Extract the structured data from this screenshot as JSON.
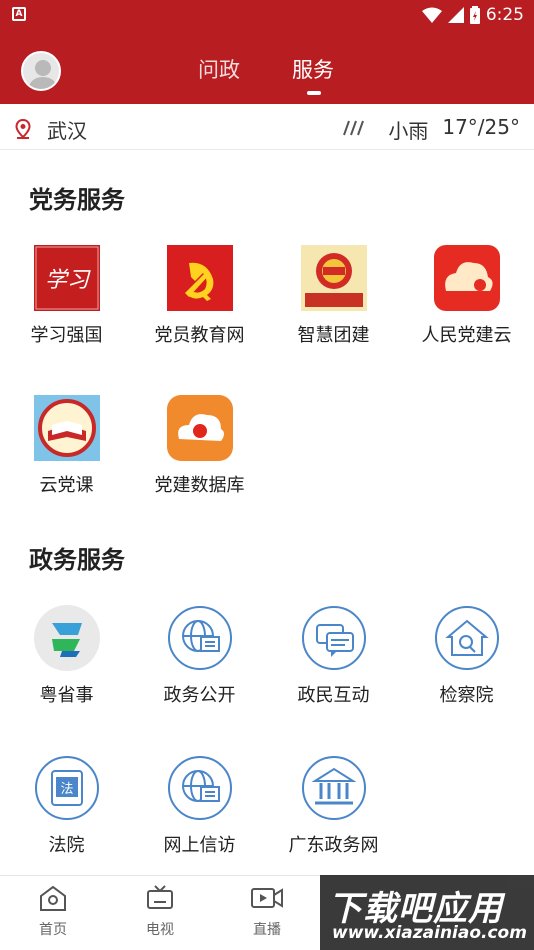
{
  "status_bar": {
    "time": "6:25",
    "app_icon_letter": "A"
  },
  "header": {
    "tabs": [
      {
        "label": "问政"
      },
      {
        "label": "服务"
      }
    ],
    "active_tab": "服务",
    "color": "#b81d22"
  },
  "location_bar": {
    "city": "武汉",
    "weather_desc": "小雨",
    "temperature": "17°/25°",
    "pin_icon": "location-pin-icon",
    "weather_icon": "rain-icon"
  },
  "party_services": {
    "title": "党务服务",
    "items": [
      {
        "label": "学习强国",
        "icon": "xuexi-qiangguo-icon"
      },
      {
        "label": "党员教育网",
        "icon": "party-emblem-icon"
      },
      {
        "label": "智慧团建",
        "icon": "youth-league-icon"
      },
      {
        "label": "人民党建云",
        "icon": "party-cloud-icon"
      },
      {
        "label": "云党课",
        "icon": "party-book-icon"
      },
      {
        "label": "党建数据库",
        "icon": "party-database-icon"
      }
    ]
  },
  "gov_services": {
    "title": "政务服务",
    "items": [
      {
        "label": "粤省事",
        "icon": "yue-sheng-shi-icon"
      },
      {
        "label": "政务公开",
        "icon": "globe-document-icon"
      },
      {
        "label": "政民互动",
        "icon": "chat-bubbles-icon"
      },
      {
        "label": "检察院",
        "icon": "house-search-icon"
      },
      {
        "label": "法院",
        "icon": "law-book-icon"
      },
      {
        "label": "网上信访",
        "icon": "globe-document-icon"
      },
      {
        "label": "广东政务网",
        "icon": "government-building-icon"
      }
    ]
  },
  "bottom_nav": {
    "items": [
      {
        "label": "首页",
        "icon": "home-icon"
      },
      {
        "label": "电视",
        "icon": "tv-icon"
      },
      {
        "label": "直播",
        "icon": "video-icon"
      }
    ]
  },
  "watermark": {
    "title": "下载吧应用",
    "url": "www.xiazainiao.com"
  }
}
